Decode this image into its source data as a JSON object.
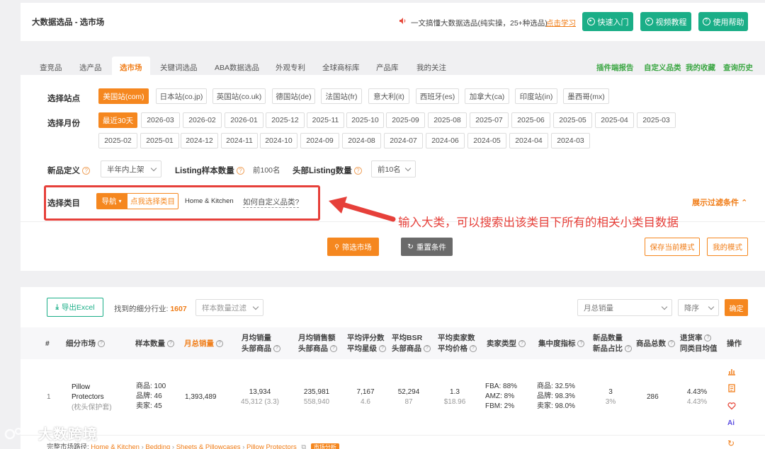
{
  "header": {
    "title": "大数据选品 - 选市场",
    "notice": "一文搞懂大数据选品(纯实操，25+种选品)",
    "notice_link": "点击学习",
    "btn_quick": "快速入门",
    "btn_video": "视频教程",
    "btn_help": "使用帮助"
  },
  "tabs": [
    "查竞品",
    "选产品",
    "选市场",
    "关键词选品",
    "ABA数据选品",
    "外观专利",
    "全球商标库",
    "产品库",
    "我的关注"
  ],
  "right_links": [
    "插件端报告",
    "自定义品类",
    "我的收藏",
    "查询历史"
  ],
  "site": {
    "label": "选择站点",
    "options": [
      "美国站(com)",
      "日本站(co.jp)",
      "英国站(co.uk)",
      "德国站(de)",
      "法国站(fr)",
      "意大利(it)",
      "西班牙(es)",
      "加拿大(ca)",
      "印度站(in)",
      "墨西哥(mx)"
    ]
  },
  "month": {
    "label": "选择月份",
    "row1": [
      "最近30天",
      "2026-03",
      "2026-02",
      "2026-01",
      "2025-12",
      "2025-11",
      "2025-10",
      "2025-09",
      "2025-08",
      "2025-07",
      "2025-06",
      "2025-05",
      "2025-04",
      "2025-03"
    ],
    "row2": [
      "2025-02",
      "2025-01",
      "2024-12",
      "2024-11",
      "2024-10",
      "2024-09",
      "2024-08",
      "2024-07",
      "2024-06",
      "2024-05",
      "2024-04",
      "2024-03"
    ]
  },
  "define": {
    "label": "新品定义",
    "value": "半年内上架",
    "sample_label": "Listing样本数量",
    "sample_value": "前100名",
    "head_label": "头部Listing数量",
    "head_value": "前10名"
  },
  "category": {
    "label": "选择类目",
    "nav": "导航",
    "pick": "点我选择类目",
    "current": "Home & Kitchen",
    "custom": "如何自定义品类?",
    "expand": "展示过滤条件"
  },
  "annotation": "输入大类，可以搜索出该类目下所有的相关小类目数据",
  "actions": {
    "filter": "筛选市场",
    "reset": "重置条件",
    "save": "保存当前模式",
    "mine": "我的模式"
  },
  "toolbar": {
    "export": "导出Excel",
    "found_label": "找到的细分行业:",
    "found_count": "1607",
    "sample_filter": "样本数量过滤",
    "sort_field": "月总销量",
    "order": "降序",
    "confirm": "确定"
  },
  "table": {
    "headers": {
      "idx": "#",
      "market": "细分市场",
      "sample": "样本数量",
      "total_sales": "月总销量",
      "avg_sales": [
        "月均销量",
        "头部商品"
      ],
      "avg_revenue": [
        "月均销售额",
        "头部商品"
      ],
      "avg_rating": [
        "平均评分数",
        "平均星级"
      ],
      "avg_bsr": [
        "平均BSR",
        "头部商品"
      ],
      "avg_sellers": [
        "平均卖家数",
        "平均价格"
      ],
      "seller_type": "卖家类型",
      "concentration": "集中度指标",
      "new_count": [
        "新品数量",
        "新品占比"
      ],
      "total_products": "商品总数",
      "return_rate": [
        "退货率",
        "同类目均值"
      ],
      "ops": "操作"
    },
    "row": {
      "idx": "1",
      "name": "Pillow Protectors",
      "name_cn": "(枕头保护套)",
      "sample": [
        "商品: 100",
        "品牌: 46",
        "卖家: 45"
      ],
      "total_sales": "1,393,489",
      "avg_sales": "13,934",
      "avg_sales_sub": "45,312 (3.3)",
      "revenue": "235,981",
      "revenue_sub": "558,940",
      "rating": "7,167",
      "stars": "4.6",
      "bsr": "52,294",
      "bsr_sub": "87",
      "sellers": "1.3",
      "price": "$18.96",
      "seller_type": [
        "FBA: 88%",
        "AMZ: 8%",
        "FBM: 2%"
      ],
      "concentration": [
        "商品: 32.5%",
        "品牌: 98.3%",
        "卖家: 98.0%"
      ],
      "new_count": "3",
      "new_ratio": "3%",
      "total": "286",
      "return": "4.43%",
      "return_avg": "4.43%"
    }
  },
  "path": {
    "label": "完整市场路径:",
    "crumbs": [
      "Home & Kitchen",
      "Bedding",
      "Sheets & Pillowcases",
      "Pillow Protectors"
    ],
    "badge": "市场分析"
  },
  "watermark": "大数跨境"
}
